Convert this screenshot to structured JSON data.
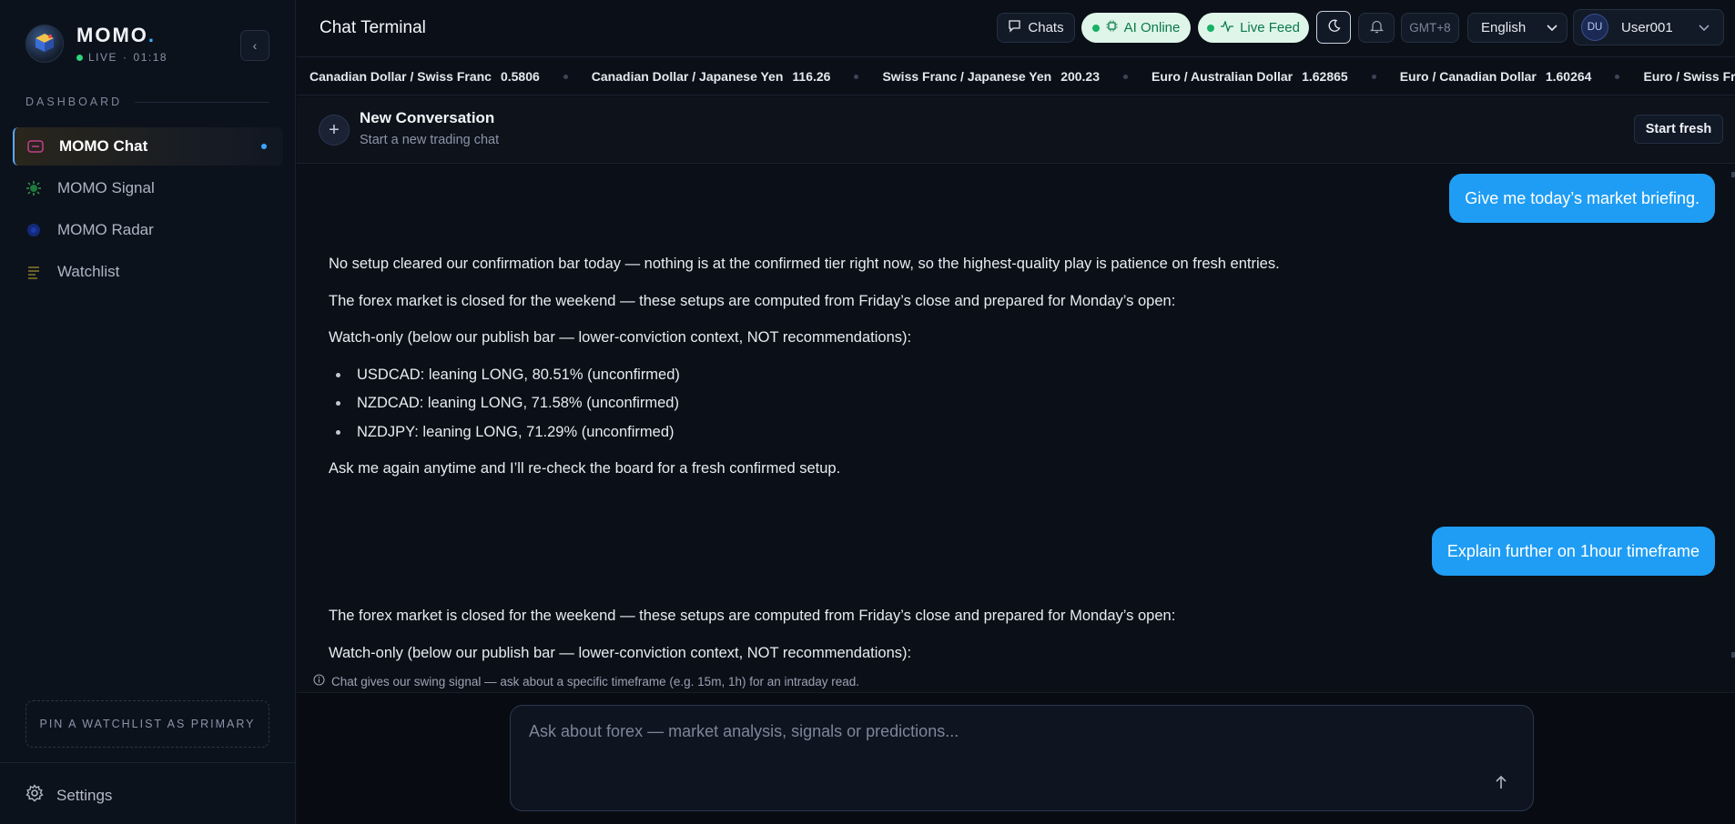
{
  "brand": {
    "name": "MOMO",
    "name_dot": ".",
    "live_label": "LIVE",
    "live_sep": "·",
    "time": "01:18",
    "logo_text": "MOMO"
  },
  "sidebar": {
    "section_label": "DASHBOARD",
    "items": [
      {
        "label": "MOMO Chat",
        "icon": "chat-icon",
        "active": true
      },
      {
        "label": "MOMO Signal",
        "icon": "signal-icon",
        "active": false
      },
      {
        "label": "MOMO Radar",
        "icon": "radar-icon",
        "active": false
      },
      {
        "label": "Watchlist",
        "icon": "watchlist-icon",
        "active": false
      }
    ],
    "pin_label": "PIN A WATCHLIST AS PRIMARY",
    "settings_label": "Settings"
  },
  "topbar": {
    "title": "Chat Terminal",
    "chats_label": "Chats",
    "ai_label": "AI Online",
    "live_feed_label": "Live Feed",
    "timezone": "GMT+8",
    "language": "English",
    "user_initials": "DU",
    "username": "User001"
  },
  "ticker": [
    {
      "pair": "Canadian Dollar / Swiss Franc",
      "value": "0.5806"
    },
    {
      "pair": "Canadian Dollar / Japanese Yen",
      "value": "116.26"
    },
    {
      "pair": "Swiss Franc / Japanese Yen",
      "value": "200.23"
    },
    {
      "pair": "Euro / Australian Dollar",
      "value": "1.62865"
    },
    {
      "pair": "Euro / Canadian Dollar",
      "value": "1.60264"
    },
    {
      "pair": "Euro / Swiss Franc",
      "value": ""
    }
  ],
  "conversation": {
    "title": "New Conversation",
    "subtitle": "Start a new trading chat",
    "fresh_label": "Start fresh",
    "new_icon": "+"
  },
  "messages": {
    "user_1": "Give me today’s market briefing.",
    "ai_1": {
      "p1": "No setup cleared our confirmation bar today — nothing is at the confirmed tier right now, so the highest-quality play is patience on fresh entries.",
      "p2": "The forex market is closed for the weekend — these setups are computed from Friday’s close and prepared for Monday’s open:",
      "p3": "Watch-only (below our publish bar — lower-conviction context, NOT recommendations):",
      "bullets": [
        "USDCAD: leaning LONG, 80.51% (unconfirmed)",
        "NZDCAD: leaning LONG, 71.58% (unconfirmed)",
        "NZDJPY: leaning LONG, 71.29% (unconfirmed)"
      ],
      "p4": "Ask me again anytime and I’ll re-check the board for a fresh confirmed setup."
    },
    "user_2": "Explain further on 1hour timeframe",
    "ai_2": {
      "p1": "The forex market is closed for the weekend — these setups are computed from Friday’s close and prepared for Monday’s open:",
      "p2": "Watch-only (below our publish bar — lower-conviction context, NOT recommendations):"
    }
  },
  "hint": "Chat gives our swing signal — ask about a specific timeframe (e.g. 15m, 1h) for an intraday read.",
  "composer": {
    "placeholder": "Ask about forex — market analysis, signals or predictions..."
  },
  "colors": {
    "accent": "#1f9df4",
    "live_green": "#16b265",
    "background": "#0b0f17"
  }
}
